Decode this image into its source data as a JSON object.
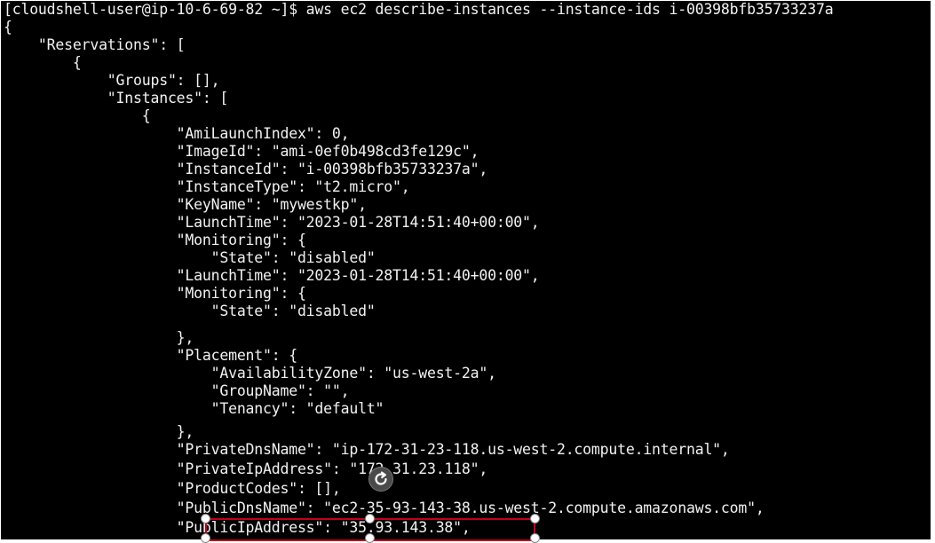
{
  "terminal": {
    "lines": [
      "[cloudshell-user@ip-10-6-69-82 ~]$ aws ec2 describe-instances --instance-ids i-00398bfb35733237a",
      "{",
      "    \"Reservations\": [",
      "        {",
      "            \"Groups\": [],",
      "            \"Instances\": [",
      "                {",
      "                    \"AmiLaunchIndex\": 0,",
      "                    \"ImageId\": \"ami-0ef0b498cd3fe129c\",",
      "                    \"InstanceId\": \"i-00398bfb35733237a\",",
      "                    \"InstanceType\": \"t2.micro\",",
      "                    \"KeyName\": \"mywestkp\",",
      "                    \"LaunchTime\": \"2023-01-28T14:51:40+00:00\",",
      "                    \"Monitoring\": {",
      "                        \"State\": \"disabled\"",
      "                    \"LaunchTime\": \"2023-01-28T14:51:40+00:00\",",
      "                    \"Monitoring\": {",
      "                        \"State\": \"disabled\"",
      "                    },",
      "                    \"Placement\": {",
      "                        \"AvailabilityZone\": \"us-west-2a\",",
      "                        \"GroupName\": \"\",",
      "                        \"Tenancy\": \"default\"",
      "                    },",
      "                    \"PrivateDnsName\": \"ip-172-31-23-118.us-west-2.compute.internal\",",
      "                    \"PrivateIpAddress\": \"172.31.23.118\",",
      "                    \"ProductCodes\": [],",
      "                    \"PublicDnsName\": \"ec2-35-93-143-38.us-west-2.compute.amazonaws.com\",",
      "                    \"PublicIpAddress\": \"35.93.143.38\","
    ]
  },
  "colors": {
    "background": "#000000",
    "text": "#f2f2f2",
    "highlight_border": "#c2001f",
    "handle_fill": "#ffffff"
  },
  "icons": {
    "rotate": "rotate-handle-icon"
  }
}
